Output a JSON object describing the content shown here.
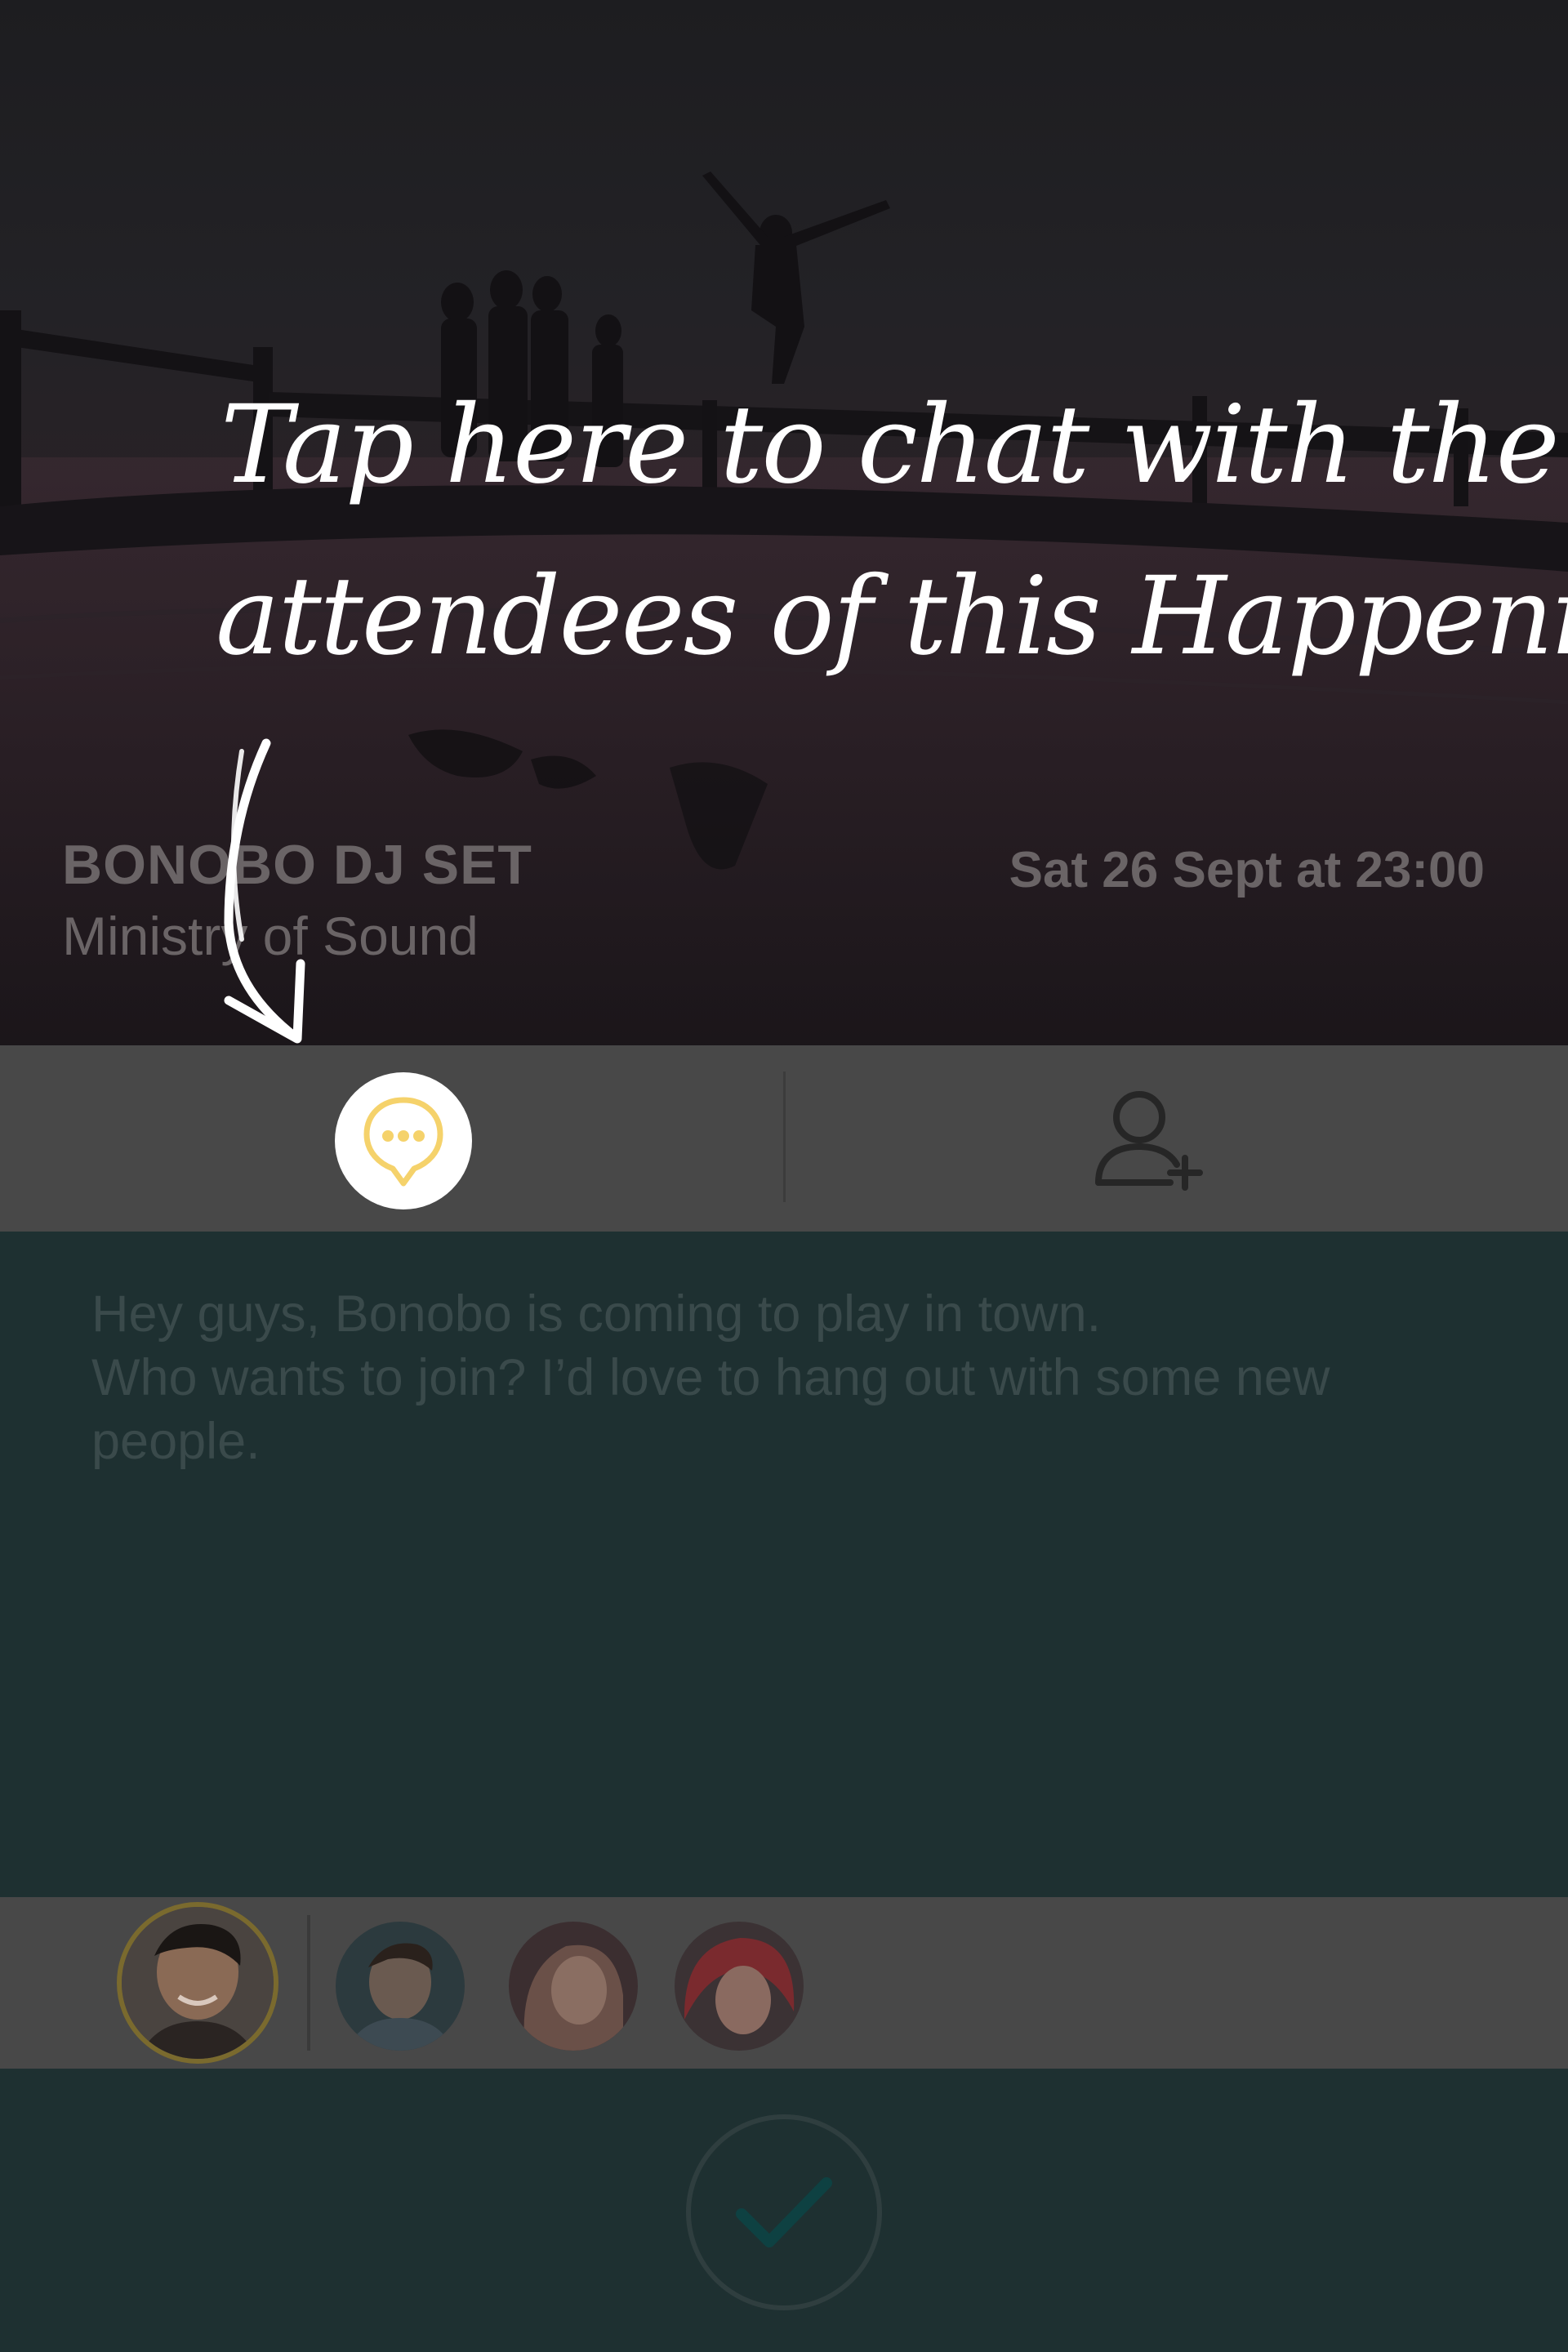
{
  "event": {
    "title": "BONOBO DJ SET",
    "venue": "Ministry of Sound",
    "datetime": "Sat 26 Sept at 23:00"
  },
  "tabs": {
    "chat_icon": "chat-bubble-icon",
    "invite_icon": "add-user-icon"
  },
  "message": {
    "lines": [
      "Hey guys, Bonobo is coming to play in town.",
      "Who wants to join? I’d love to hang out with some new",
      "people."
    ]
  },
  "attendees": {
    "host": "avatar",
    "others": [
      "avatar",
      "avatar",
      "avatar"
    ]
  },
  "confirm": {
    "icon": "checkmark-icon"
  },
  "coachmark": {
    "lines": [
      "Tap here to chat with the",
      "attendees of this Happening"
    ],
    "arrow_icon": "curved-arrow-icon"
  },
  "colors": {
    "accent": "#f5d26b",
    "teal_bg": "#1e3031",
    "bar_bg": "#484848"
  }
}
